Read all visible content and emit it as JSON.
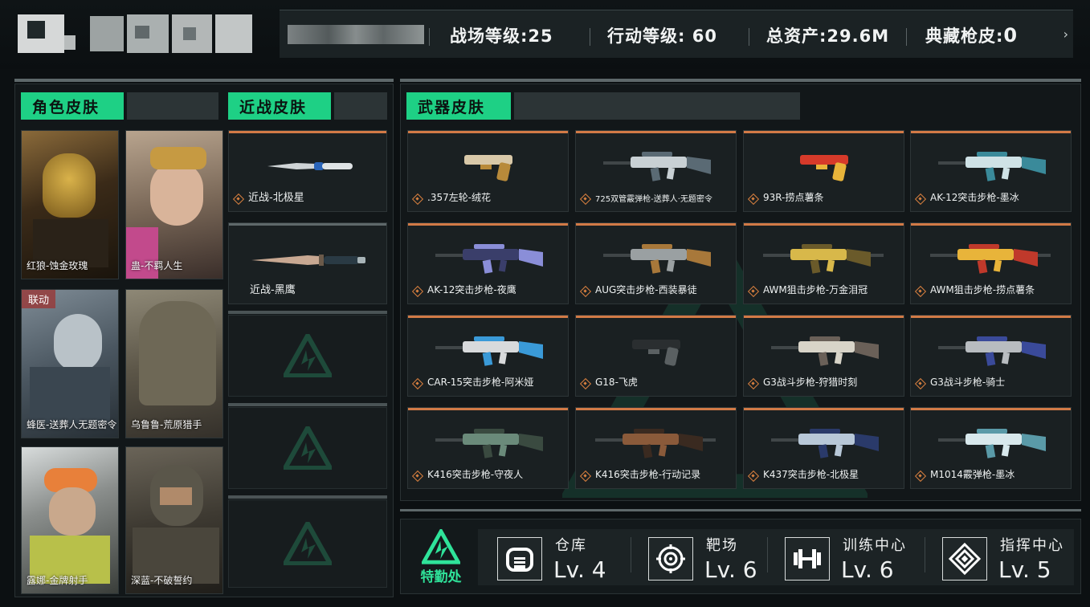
{
  "header": {
    "stats": [
      {
        "label": "战场等级:25"
      },
      {
        "label": "行动等级: 60"
      },
      {
        "label": "总资产:29.6M"
      },
      {
        "label": "典藏枪皮:"
      },
      {
        "value": "0"
      }
    ],
    "arrow": "›"
  },
  "roles": {
    "tab": "角色皮肤",
    "items": [
      {
        "name": "红狼-蚀金玫瑰",
        "tag": ""
      },
      {
        "name": "蛊-不羁人生",
        "tag": ""
      },
      {
        "name": "蜂医-送葬人无题密令",
        "tag": "联动"
      },
      {
        "name": "乌鲁鲁-荒原猎手",
        "tag": ""
      },
      {
        "name": "露娜-金牌射手",
        "tag": ""
      },
      {
        "name": "深蓝-不破誓约",
        "tag": ""
      }
    ]
  },
  "melee": {
    "tab": "近战皮肤",
    "items": [
      {
        "name": "近战-北极星"
      },
      {
        "name": "近战-黑鹰"
      }
    ]
  },
  "weapons": {
    "tab": "武器皮肤",
    "items": [
      {
        "name": ".357左轮-绒花"
      },
      {
        "name": "725双管霰弹枪-送葬人·无题密令"
      },
      {
        "name": "93R-捞点薯条"
      },
      {
        "name": "AK-12突击步枪-墨冰"
      },
      {
        "name": "AK-12突击步枪-夜鹰"
      },
      {
        "name": "AUG突击步枪-西装暴徒"
      },
      {
        "name": "AWM狙击步枪-万金泪冠"
      },
      {
        "name": "AWM狙击步枪-捞点薯条"
      },
      {
        "name": "CAR-15突击步枪-阿米娅"
      },
      {
        "name": "G18-飞虎"
      },
      {
        "name": "G3战斗步枪-狩猎时刻"
      },
      {
        "name": "G3战斗步枪-骑士"
      },
      {
        "name": "K416突击步枪-守夜人"
      },
      {
        "name": "K416突击步枪-行动记录"
      },
      {
        "name": "K437突击步枪-北极星"
      },
      {
        "name": "M1014霰弹枪-墨冰"
      }
    ]
  },
  "facility": {
    "title": "特勤处",
    "items": [
      {
        "name": "仓库",
        "level": "Lv. 4",
        "icon": "warehouse-icon"
      },
      {
        "name": "靶场",
        "level": "Lv. 6",
        "icon": "target-icon"
      },
      {
        "name": "训练中心",
        "level": "Lv. 6",
        "icon": "dumbbell-icon"
      },
      {
        "name": "指挥中心",
        "level": "Lv. 5",
        "icon": "command-icon"
      }
    ]
  },
  "colors": {
    "accent": "#1ed085",
    "orange": "#d27a46",
    "red": "#c0393e"
  }
}
